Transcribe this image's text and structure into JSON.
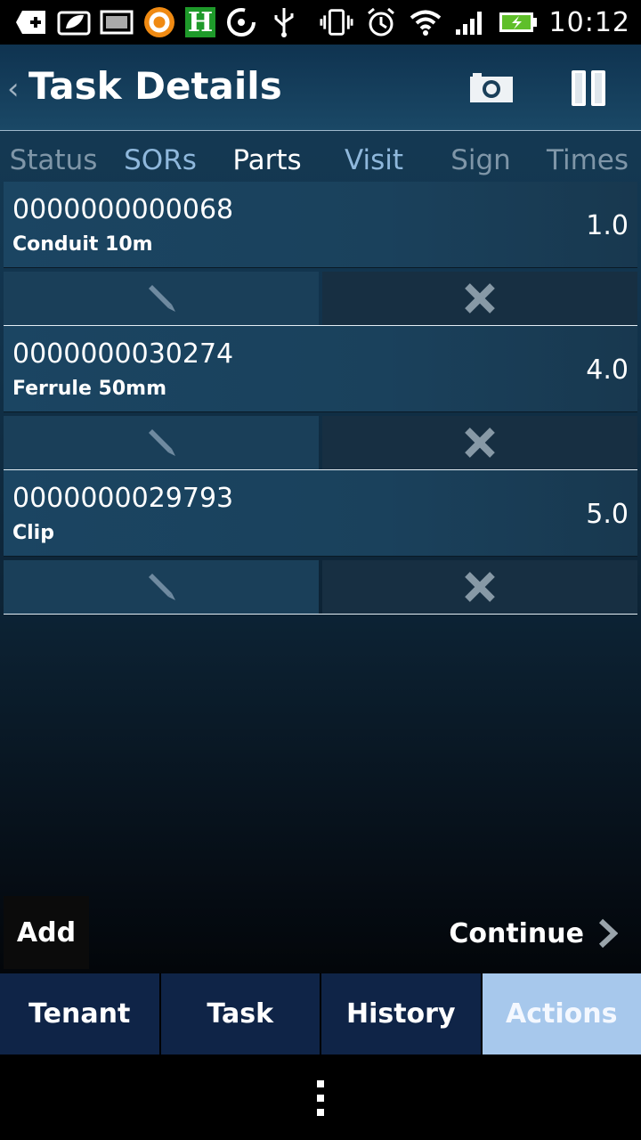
{
  "status_bar": {
    "time": "10:12",
    "left_icons": [
      "add-icon",
      "leaf-message-icon",
      "image-icon",
      "app-circle-icon",
      "h-app-icon",
      "sync-icon",
      "usb-icon"
    ],
    "right_icons": [
      "vibrate-icon",
      "alarm-icon",
      "wifi-icon",
      "signal-icon",
      "battery-icon"
    ],
    "h_letter": "H"
  },
  "header": {
    "back_symbol": "‹",
    "title": "Task Details"
  },
  "tabs": [
    {
      "label": "Status"
    },
    {
      "label": "SORs"
    },
    {
      "label": "Parts"
    },
    {
      "label": "Visit"
    },
    {
      "label": "Sign"
    },
    {
      "label": "Times"
    }
  ],
  "parts": [
    {
      "code": "0000000000068",
      "description": "Conduit 10m",
      "quantity": "1.0"
    },
    {
      "code": "0000000030274",
      "description": "Ferrule 50mm",
      "quantity": "4.0"
    },
    {
      "code": "0000000029793",
      "description": "Clip",
      "quantity": "5.0"
    }
  ],
  "buttons": {
    "add": "Add",
    "continue": "Continue"
  },
  "bottom_tabs": [
    {
      "label": "Tenant"
    },
    {
      "label": "Task"
    },
    {
      "label": "History"
    },
    {
      "label": "Actions"
    }
  ],
  "colors": {
    "accent_active_tab": "#a7c8ec",
    "bottom_tab_bg": "#0f2447",
    "header_bg": "#153b55"
  }
}
